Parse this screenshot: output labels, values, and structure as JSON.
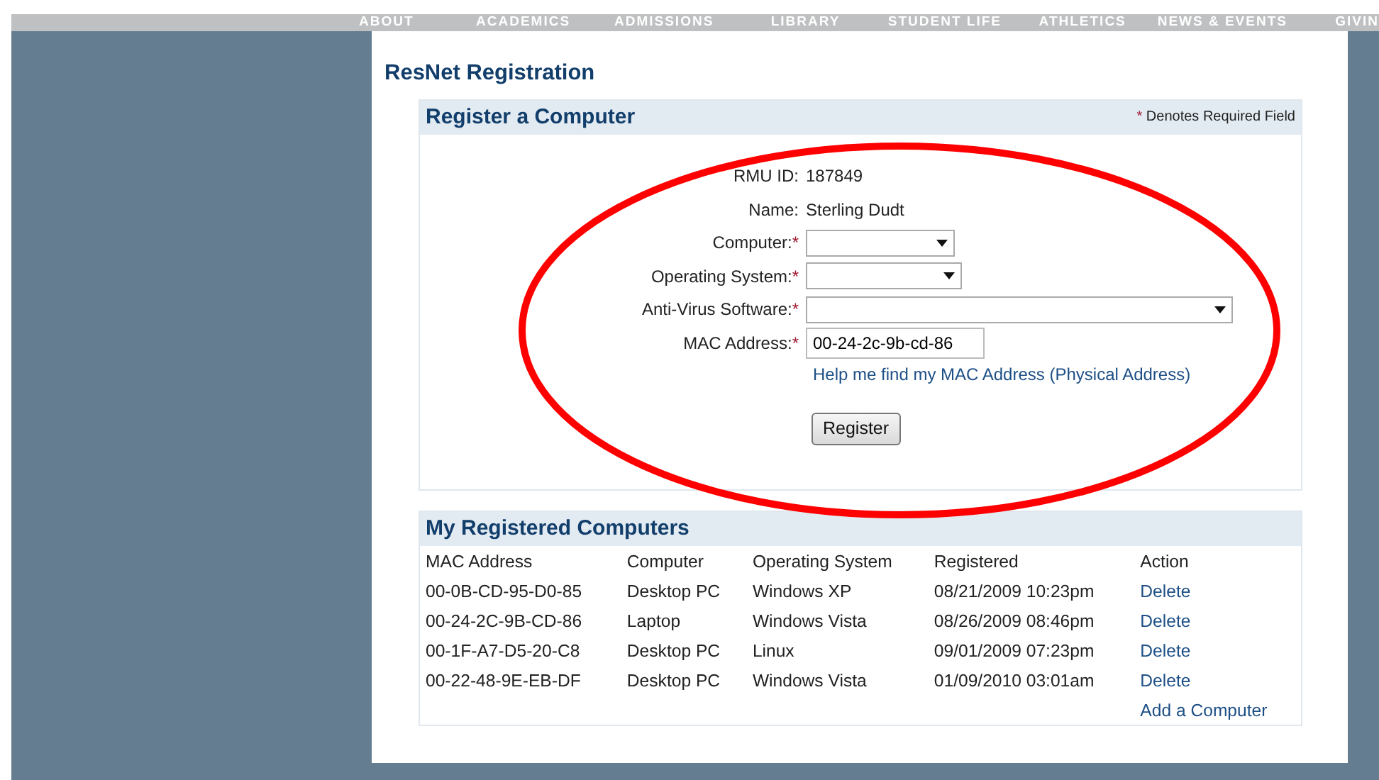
{
  "nav": [
    "ABOUT",
    "ACADEMICS",
    "ADMISSIONS",
    "LIBRARY",
    "STUDENT LIFE",
    "ATHLETICS",
    "NEWS & EVENTS",
    "GIVIN"
  ],
  "page_title": "ResNet Registration",
  "register": {
    "title": "Register a Computer",
    "required_mark": "*",
    "required_note": "Denotes Required Field",
    "fields": [
      {
        "kind": "text",
        "label": "RMU ID:",
        "value": "187849",
        "required": false
      },
      {
        "kind": "text",
        "label": "Name:",
        "value": "Sterling Dudt",
        "required": false
      },
      {
        "kind": "select",
        "label": "Computer:",
        "required": true
      },
      {
        "kind": "select",
        "label": "Operating System:",
        "required": true
      },
      {
        "kind": "select",
        "label": "Anti-Virus Software:",
        "required": true
      },
      {
        "kind": "input",
        "label": "MAC Address:",
        "value": "00-24-2c-9b-cd-86",
        "required": true
      }
    ],
    "help_link": "Help me find my MAC Address (Physical Address)",
    "button": "Register"
  },
  "registered": {
    "title": "My Registered Computers",
    "columns": [
      "MAC Address",
      "Computer",
      "Operating System",
      "Registered",
      "Action"
    ],
    "rows": [
      [
        "00-0B-CD-95-D0-85",
        "Desktop PC",
        "Windows XP",
        "08/21/2009 10:23pm",
        "Delete"
      ],
      [
        "00-24-2C-9B-CD-86",
        "Laptop",
        "Windows Vista",
        "08/26/2009 08:46pm",
        "Delete"
      ],
      [
        "00-1F-A7-D5-20-C8",
        "Desktop PC",
        "Linux",
        "09/01/2009 07:23pm",
        "Delete"
      ],
      [
        "00-22-48-9E-EB-DF",
        "Desktop PC",
        "Windows Vista",
        "01/09/2010 03:01am",
        "Delete"
      ]
    ],
    "add_link": "Add a Computer"
  },
  "annotation": {
    "kind": "ellipse",
    "color": "#ff0000"
  }
}
